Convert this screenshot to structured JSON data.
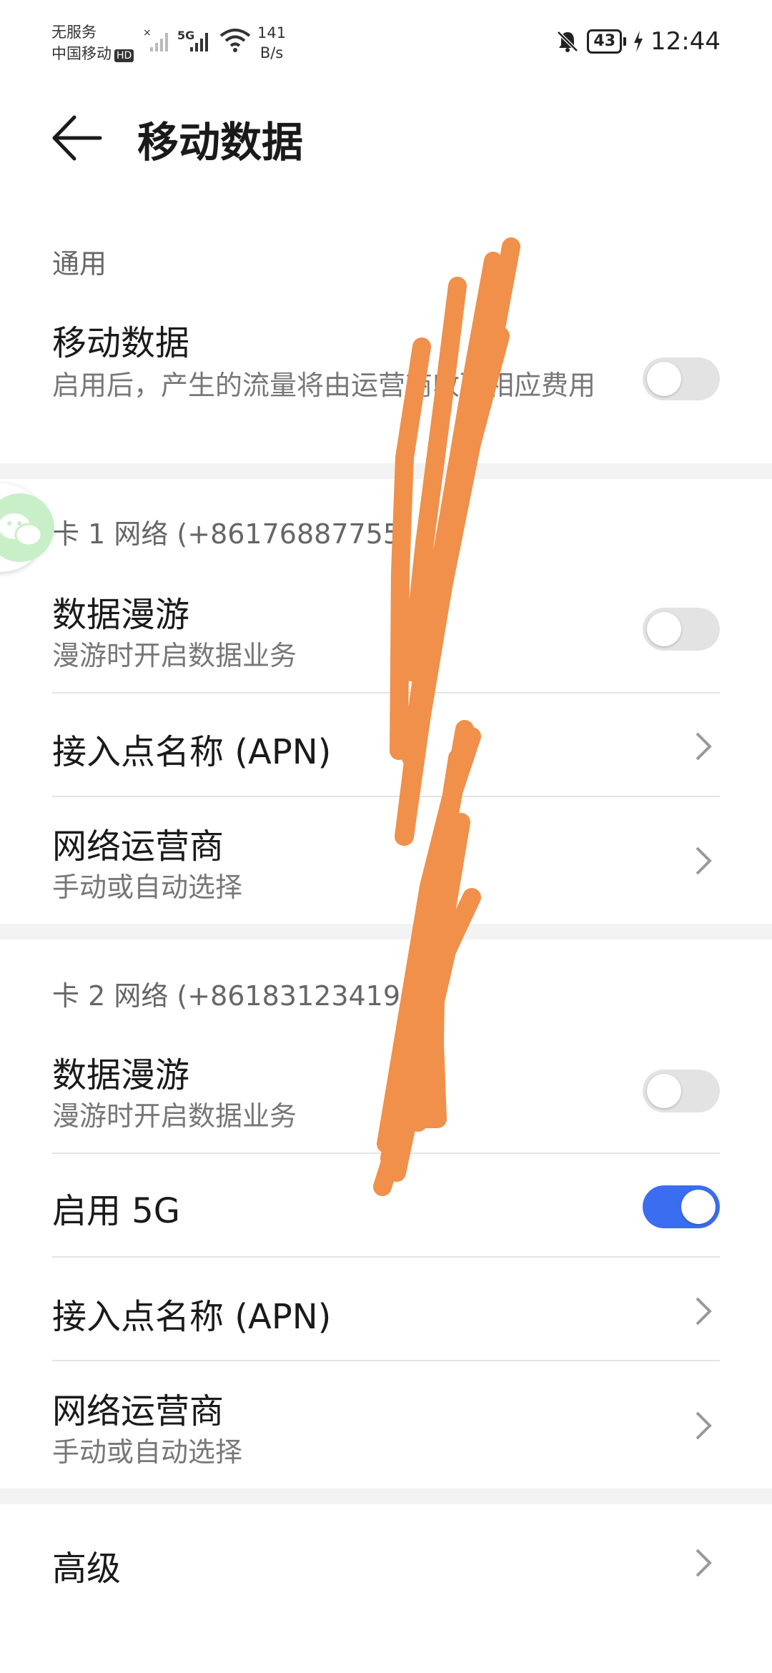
{
  "status_bar": {
    "line1": "无服务",
    "line2": "中国移动",
    "hd": "HD",
    "net_type": "5G",
    "speed_value": "141",
    "speed_unit": "B/s",
    "battery": "43",
    "time": "12:44"
  },
  "header": {
    "title": "移动数据"
  },
  "general": {
    "label": "通用",
    "mobile_data": {
      "title": "移动数据",
      "subtitle": "启用后，产生的流量将由运营商收取相应费用",
      "enabled": false
    }
  },
  "sim1": {
    "label": "卡 1 网络 (+86176887755",
    "roaming": {
      "title": "数据漫游",
      "subtitle": "漫游时开启数据业务",
      "enabled": false
    },
    "apn": {
      "title": "接入点名称 (APN)"
    },
    "carrier": {
      "title": "网络运营商",
      "subtitle": "手动或自动选择"
    }
  },
  "sim2": {
    "label": "卡 2 网络 (+86183123419",
    "roaming": {
      "title": "数据漫游",
      "subtitle": "漫游时开启数据业务",
      "enabled": false
    },
    "enable_5g": {
      "title": "启用 5G",
      "enabled": true
    },
    "apn": {
      "title": "接入点名称 (APN)"
    },
    "carrier": {
      "title": "网络运营商",
      "subtitle": "手动或自动选择"
    }
  },
  "advanced": {
    "title": "高级"
  },
  "colors": {
    "accent": "#3a6df0",
    "scribble": "#f0904a",
    "divider": "#e4e4e4"
  }
}
